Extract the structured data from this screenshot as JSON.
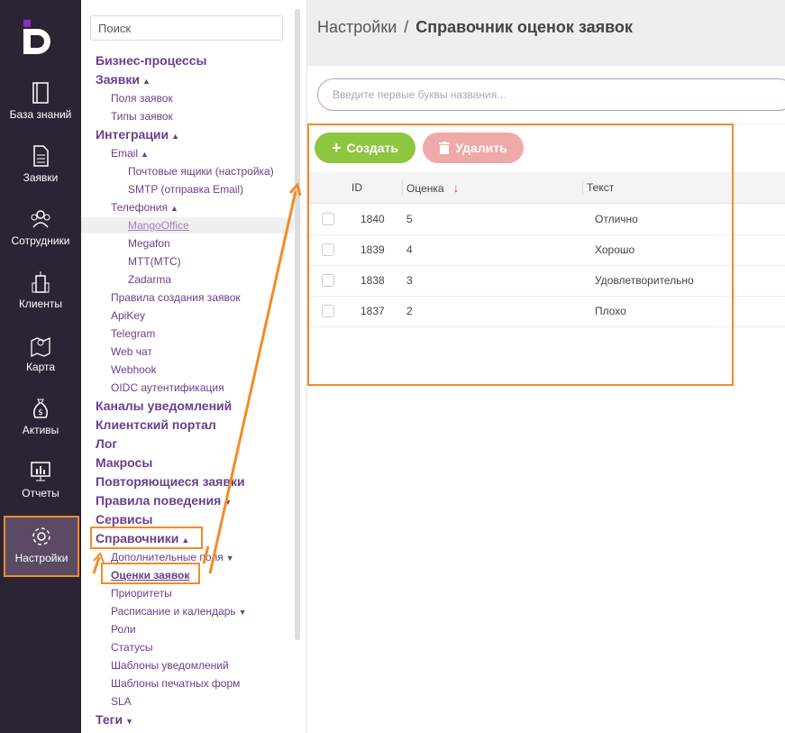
{
  "rail": {
    "items": [
      {
        "label": "База знаний",
        "icon": "book-icon"
      },
      {
        "label": "Заявки",
        "icon": "document-icon"
      },
      {
        "label": "Сотрудники",
        "icon": "people-icon"
      },
      {
        "label": "Клиенты",
        "icon": "building-icon"
      },
      {
        "label": "Карта",
        "icon": "map-icon"
      },
      {
        "label": "Активы",
        "icon": "money-bag-icon"
      },
      {
        "label": "Отчеты",
        "icon": "chart-monitor-icon"
      },
      {
        "label": "Настройки",
        "icon": "gear-icon"
      }
    ]
  },
  "tree": {
    "search_placeholder": "Поиск",
    "items": [
      {
        "label": "Бизнес-процессы"
      },
      {
        "label": "Заявки",
        "arrow": "▲"
      },
      {
        "label": "Поля заявок"
      },
      {
        "label": "Типы заявок"
      },
      {
        "label": "Интеграции",
        "arrow": "▲"
      },
      {
        "label": "Email",
        "arrow": "▲"
      },
      {
        "label": "Почтовые ящики (настройка)"
      },
      {
        "label": "SMTP (отправка Email)"
      },
      {
        "label": "Телефония",
        "arrow": "▲"
      },
      {
        "label": "MangoOffice"
      },
      {
        "label": "Megafon"
      },
      {
        "label": "МТТ(МТС)"
      },
      {
        "label": "Zadarma"
      },
      {
        "label": "Правила создания заявок"
      },
      {
        "label": "ApiKey"
      },
      {
        "label": "Telegram"
      },
      {
        "label": "Web чат"
      },
      {
        "label": "Webhook"
      },
      {
        "label": "OIDC аутентификация"
      },
      {
        "label": "Каналы уведомлений"
      },
      {
        "label": "Клиентский портал"
      },
      {
        "label": "Лог"
      },
      {
        "label": "Макросы"
      },
      {
        "label": "Повторяющиеся заявки"
      },
      {
        "label": "Правила поведения",
        "arrow": "▼"
      },
      {
        "label": "Сервисы"
      },
      {
        "label": "Справочники",
        "arrow": "▲"
      },
      {
        "label": "Дополнительные поля",
        "arrow": "▼"
      },
      {
        "label": "Оценки заявок"
      },
      {
        "label": "Приоритеты"
      },
      {
        "label": "Расписание и календарь",
        "arrow": "▼"
      },
      {
        "label": "Роли"
      },
      {
        "label": "Статусы"
      },
      {
        "label": "Шаблоны уведомлений"
      },
      {
        "label": "Шаблоны печатных форм"
      },
      {
        "label": "SLA"
      },
      {
        "label": "Теги",
        "arrow": "▼"
      }
    ]
  },
  "header": {
    "crumb_root": "Настройки",
    "crumb_sep": "/",
    "title": "Справочник оценок заявок"
  },
  "search": {
    "placeholder": "Введите первые буквы названия..."
  },
  "toolbar": {
    "create_label": "Создать",
    "create_icon": "+",
    "delete_label": "Удалить"
  },
  "table": {
    "columns": [
      "ID",
      "Оценка",
      "Текст"
    ],
    "sort_icon": "↓",
    "rows": [
      {
        "id": "1840",
        "score": "5",
        "text": "Отлично"
      },
      {
        "id": "1839",
        "score": "4",
        "text": "Хорошо"
      },
      {
        "id": "1838",
        "score": "3",
        "text": "Удовлетворительно"
      },
      {
        "id": "1837",
        "score": "2",
        "text": "Плохо"
      }
    ]
  },
  "colors": {
    "rail_bg": "#2b2434",
    "accent_purple": "#6b3f8c",
    "create_green": "#8dc63f",
    "delete_pink": "#f0a9a9",
    "highlight_orange": "#f28c28"
  }
}
